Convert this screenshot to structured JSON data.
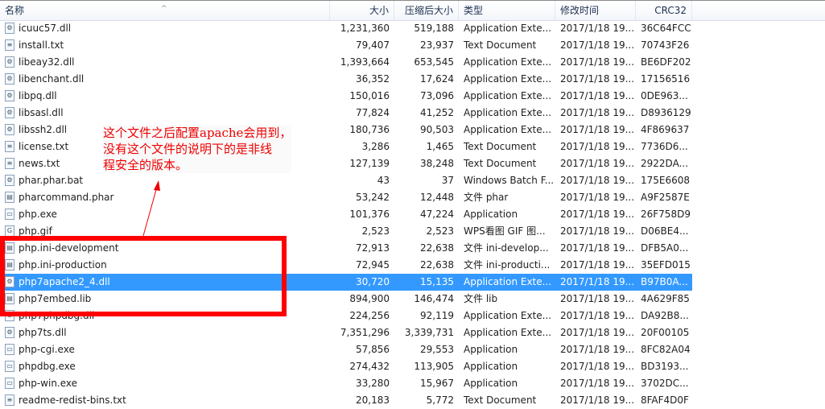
{
  "columns": {
    "name": "名称",
    "size": "大小",
    "compressed": "压缩后大小",
    "type": "类型",
    "modified": "修改时间",
    "crc": "CRC32"
  },
  "files": [
    {
      "name": "icuuc57.dll",
      "size": "1,231,360",
      "compressed": "519,188",
      "type": "Application Exte...",
      "modified": "2017/1/18 19...",
      "crc": "36C64FCC",
      "icon": "dll-icon"
    },
    {
      "name": "install.txt",
      "size": "79,407",
      "compressed": "23,937",
      "type": "Text Document",
      "modified": "2017/1/18 19...",
      "crc": "70743F26",
      "icon": "text-file-icon"
    },
    {
      "name": "libeay32.dll",
      "size": "1,393,664",
      "compressed": "653,545",
      "type": "Application Exte...",
      "modified": "2017/1/18 19...",
      "crc": "BE6DF202",
      "icon": "dll-icon"
    },
    {
      "name": "libenchant.dll",
      "size": "36,352",
      "compressed": "17,624",
      "type": "Application Exte...",
      "modified": "2017/1/18 19...",
      "crc": "17156516",
      "icon": "dll-icon"
    },
    {
      "name": "libpq.dll",
      "size": "150,016",
      "compressed": "73,096",
      "type": "Application Exte...",
      "modified": "2017/1/18 19...",
      "crc": "0DE963...",
      "icon": "dll-icon"
    },
    {
      "name": "libsasl.dll",
      "size": "77,824",
      "compressed": "41,252",
      "type": "Application Exte...",
      "modified": "2017/1/18 19...",
      "crc": "D8936129",
      "icon": "dll-icon"
    },
    {
      "name": "libssh2.dll",
      "size": "180,736",
      "compressed": "90,503",
      "type": "Application Exte...",
      "modified": "2017/1/18 19...",
      "crc": "4F869637",
      "icon": "dll-icon"
    },
    {
      "name": "license.txt",
      "size": "3,286",
      "compressed": "1,465",
      "type": "Text Document",
      "modified": "2017/1/18 19...",
      "crc": "7736D6...",
      "icon": "text-file-icon"
    },
    {
      "name": "news.txt",
      "size": "127,139",
      "compressed": "38,248",
      "type": "Text Document",
      "modified": "2017/1/18 19...",
      "crc": "2922DA...",
      "icon": "text-file-icon"
    },
    {
      "name": "phar.phar.bat",
      "size": "43",
      "compressed": "37",
      "type": "Windows Batch F...",
      "modified": "2017/1/18 19...",
      "crc": "175E6608",
      "icon": "batch-file-icon"
    },
    {
      "name": "pharcommand.phar",
      "size": "53,242",
      "compressed": "12,448",
      "type": "文件 phar",
      "modified": "2017/1/18 19...",
      "crc": "A9F2587E",
      "icon": "generic-file-icon"
    },
    {
      "name": "php.exe",
      "size": "101,376",
      "compressed": "47,224",
      "type": "Application",
      "modified": "2017/1/18 19...",
      "crc": "26F758D9",
      "icon": "exe-icon"
    },
    {
      "name": "php.gif",
      "size": "2,523",
      "compressed": "2,523",
      "type": "WPS看图 GIF 图...",
      "modified": "2017/1/18 19...",
      "crc": "D06BE4...",
      "icon": "gif-icon"
    },
    {
      "name": "php.ini-development",
      "size": "72,913",
      "compressed": "22,638",
      "type": "文件 ini-develop...",
      "modified": "2017/1/18 19...",
      "crc": "DFB5A0...",
      "icon": "generic-file-icon"
    },
    {
      "name": "php.ini-production",
      "size": "72,945",
      "compressed": "22,638",
      "type": "文件 ini-producti...",
      "modified": "2017/1/18 19...",
      "crc": "35EFD015",
      "icon": "generic-file-icon"
    },
    {
      "name": "php7apache2_4.dll",
      "size": "30,720",
      "compressed": "15,135",
      "type": "Application Exte...",
      "modified": "2017/1/18 19...",
      "crc": "B97B0A...",
      "icon": "dll-icon",
      "selected": true
    },
    {
      "name": "php7embed.lib",
      "size": "894,900",
      "compressed": "146,474",
      "type": "文件 lib",
      "modified": "2017/1/18 19...",
      "crc": "4A629F85",
      "icon": "generic-file-icon"
    },
    {
      "name": "php7phpdbg.dll",
      "size": "224,256",
      "compressed": "92,119",
      "type": "Application Exte...",
      "modified": "2017/1/18 19...",
      "crc": "DA92B8...",
      "icon": "dll-icon"
    },
    {
      "name": "php7ts.dll",
      "size": "7,351,296",
      "compressed": "3,339,731",
      "type": "Application Exte...",
      "modified": "2017/1/18 19...",
      "crc": "20F00105",
      "icon": "dll-icon"
    },
    {
      "name": "php-cgi.exe",
      "size": "57,856",
      "compressed": "29,553",
      "type": "Application",
      "modified": "2017/1/18 19...",
      "crc": "8FC82A04",
      "icon": "exe-icon"
    },
    {
      "name": "phpdbg.exe",
      "size": "274,432",
      "compressed": "113,905",
      "type": "Application",
      "modified": "2017/1/18 19...",
      "crc": "BD3193...",
      "icon": "exe-icon"
    },
    {
      "name": "php-win.exe",
      "size": "33,280",
      "compressed": "15,967",
      "type": "Application",
      "modified": "2017/1/18 19...",
      "crc": "3702DC...",
      "icon": "exe-icon"
    },
    {
      "name": "readme-redist-bins.txt",
      "size": "20,183",
      "compressed": "5,772",
      "type": "Text Document",
      "modified": "2017/1/18 19...",
      "crc": "8FAF4D0F",
      "icon": "text-file-icon"
    }
  ],
  "annotation": {
    "lines": [
      "这个文件之后配置apache会用到，",
      "没有这个文件的说明下的是非线",
      "程安全的版本。"
    ],
    "color": "#ff0000"
  },
  "colors": {
    "selection": "#3399ff",
    "annotation": "#ff0000"
  }
}
